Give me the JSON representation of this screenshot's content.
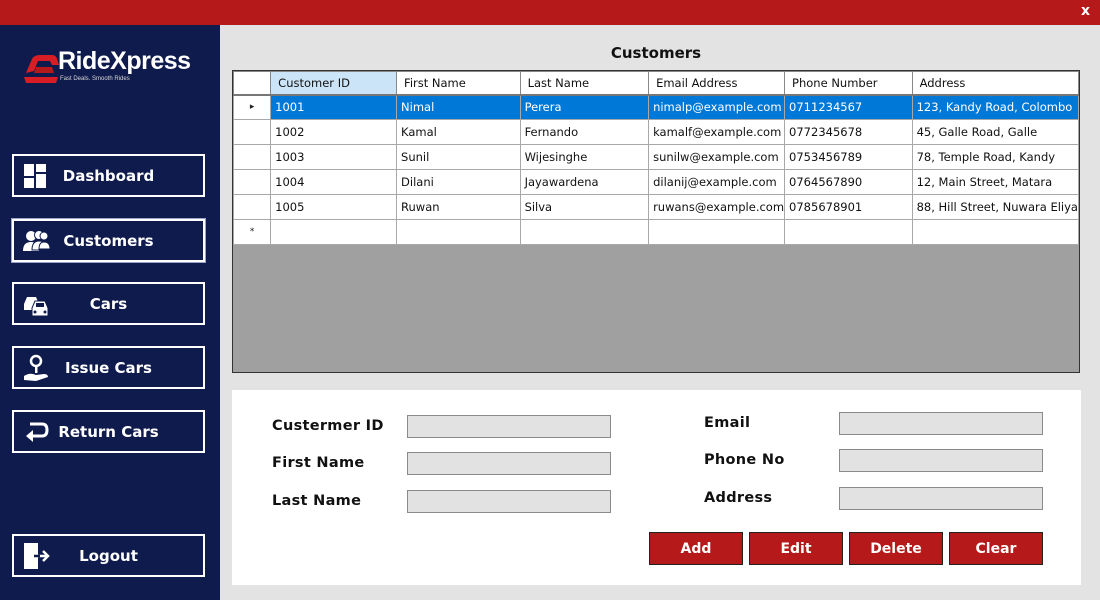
{
  "window": {
    "close_label": "x"
  },
  "brand": {
    "name": "RideXpress",
    "tagline": "Fast Deals. Smooth Rides",
    "accent": "#b5191a",
    "sidebar_bg": "#0f1b4c"
  },
  "sidebar": {
    "items": [
      {
        "label": "Dashboard",
        "icon": "dashboard-icon"
      },
      {
        "label": "Customers",
        "icon": "customers-icon"
      },
      {
        "label": "Cars",
        "icon": "cars-icon"
      },
      {
        "label": "Issue Cars",
        "icon": "issue-cars-icon"
      },
      {
        "label": "Return Cars",
        "icon": "return-cars-icon"
      }
    ],
    "logout": {
      "label": "Logout",
      "icon": "logout-icon"
    }
  },
  "main": {
    "title": "Customers",
    "table": {
      "columns": [
        "Customer ID",
        "First Name",
        "Last Name",
        "Email Address",
        "Phone Number",
        "Address"
      ],
      "rows": [
        [
          "1001",
          "Nimal",
          "Perera",
          "nimalp@example.com",
          "0711234567",
          "123, Kandy Road, Colombo"
        ],
        [
          "1002",
          "Kamal",
          "Fernando",
          "kamalf@example.com",
          "0772345678",
          "45, Galle Road, Galle"
        ],
        [
          "1003",
          "Sunil",
          "Wijesinghe",
          "sunilw@example.com",
          "0753456789",
          "78, Temple Road, Kandy"
        ],
        [
          "1004",
          "Dilani",
          "Jayawardena",
          "dilanij@example.com",
          "0764567890",
          "12, Main Street, Matara"
        ],
        [
          "1005",
          "Ruwan",
          "Silva",
          "ruwans@example.com",
          "0785678901",
          "88, Hill Street, Nuwara Eliya"
        ]
      ],
      "selected_row": 0,
      "current_row_marker": "▸",
      "new_row_marker": "*"
    }
  },
  "form": {
    "customer_id": {
      "label": "Custermer ID",
      "value": ""
    },
    "first_name": {
      "label": "First Name",
      "value": ""
    },
    "last_name": {
      "label": "Last Name",
      "value": ""
    },
    "email": {
      "label": "Email",
      "value": ""
    },
    "phone": {
      "label": "Phone No",
      "value": ""
    },
    "address": {
      "label": "Address",
      "value": ""
    }
  },
  "actions": {
    "add": "Add",
    "edit": "Edit",
    "delete": "Delete",
    "clear": "Clear"
  }
}
